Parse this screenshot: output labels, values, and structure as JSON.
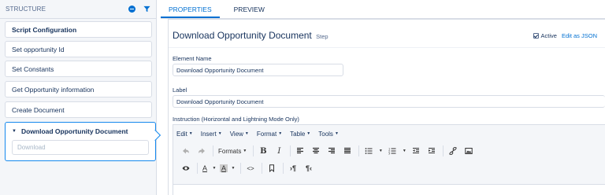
{
  "left": {
    "header_title": "STRUCTURE",
    "steps": [
      {
        "label": "Script Configuration"
      },
      {
        "label": "Set opportunity Id"
      },
      {
        "label": "Set Constants"
      },
      {
        "label": "Get Opportunity information"
      },
      {
        "label": "Create Document"
      }
    ],
    "active_step": {
      "label": "Download Opportunity Document",
      "sub_label": "Download"
    }
  },
  "tabs": [
    {
      "label": "PROPERTIES",
      "active": true
    },
    {
      "label": "PREVIEW",
      "active": false
    }
  ],
  "detail": {
    "title": "Download Opportunity Document",
    "kind": "Step",
    "active_label": "Active",
    "active_checked": true,
    "edit_json_label": "Edit as JSON",
    "element_name_label": "Element Name",
    "element_name_value": "Download Opportunity Document",
    "label_label": "Label",
    "label_value": "Download Opportunity Document",
    "instruction_label": "Instruction (Horizontal and Lightning Mode Only)"
  },
  "editor": {
    "menus": [
      "Edit",
      "Insert",
      "View",
      "Format",
      "Table",
      "Tools"
    ],
    "formats_label": "Formats"
  },
  "colors": {
    "accent": "#0070d2",
    "active_border": "#1589ee",
    "panel_bg": "#f4f6f9",
    "text": "#16325c"
  }
}
